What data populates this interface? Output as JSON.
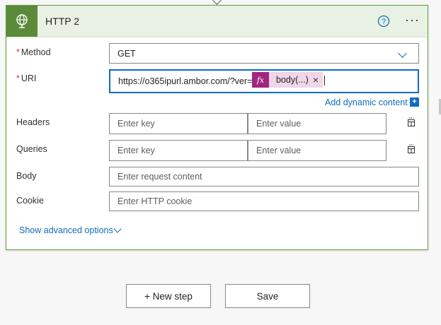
{
  "card": {
    "title": "HTTP 2",
    "icon": "globe-icon",
    "help_icon": "help-circle-icon",
    "more_label": "···",
    "accent_color": "#5b8b39"
  },
  "fields": {
    "method": {
      "required_mark": "*",
      "label": "Method",
      "value": "GET"
    },
    "uri": {
      "required_mark": "*",
      "label": "URI",
      "value_prefix": "https://o365ipurl.ambor.com/?ver=",
      "token": {
        "icon_label": "fx",
        "label": "body(...)",
        "close": "×"
      }
    },
    "add_dynamic": {
      "label": "Add dynamic content",
      "icon": "+"
    },
    "headers": {
      "label": "Headers",
      "key_placeholder": "Enter key",
      "value_placeholder": "Enter value"
    },
    "queries": {
      "label": "Queries",
      "key_placeholder": "Enter key",
      "value_placeholder": "Enter value"
    },
    "body": {
      "label": "Body",
      "placeholder": "Enter request content"
    },
    "cookie": {
      "label": "Cookie",
      "placeholder": "Enter HTTP cookie"
    }
  },
  "advanced": {
    "label": "Show advanced options"
  },
  "actions": {
    "new_step": "+ New step",
    "save": "Save"
  }
}
